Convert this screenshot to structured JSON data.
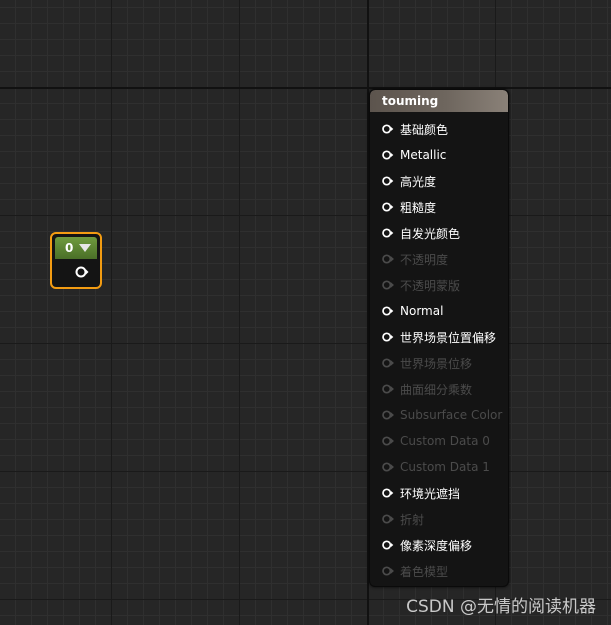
{
  "constant_node": {
    "value": "0"
  },
  "material_node": {
    "title": "touming",
    "pins": [
      {
        "label": "基础颜色",
        "enabled": true
      },
      {
        "label": "Metallic",
        "enabled": true
      },
      {
        "label": "高光度",
        "enabled": true
      },
      {
        "label": "粗糙度",
        "enabled": true
      },
      {
        "label": "自发光颜色",
        "enabled": true
      },
      {
        "label": "不透明度",
        "enabled": false
      },
      {
        "label": "不透明蒙版",
        "enabled": false
      },
      {
        "label": "Normal",
        "enabled": true
      },
      {
        "label": "世界场景位置偏移",
        "enabled": true
      },
      {
        "label": "世界场景位移",
        "enabled": false
      },
      {
        "label": "曲面细分乘数",
        "enabled": false
      },
      {
        "label": "Subsurface Color",
        "enabled": false
      },
      {
        "label": "Custom Data 0",
        "enabled": false
      },
      {
        "label": "Custom Data 1",
        "enabled": false
      },
      {
        "label": "环境光遮挡",
        "enabled": true
      },
      {
        "label": "折射",
        "enabled": false
      },
      {
        "label": "像素深度偏移",
        "enabled": true
      },
      {
        "label": "着色模型",
        "enabled": false
      }
    ]
  },
  "watermark": "CSDN @无情的阅读机器",
  "colors": {
    "canvas_background": "#262626",
    "constant_node_border": "#f39c12",
    "constant_node_header": "#5a8432",
    "material_node_header": "#6e665e",
    "pin_enabled": "#ffffff",
    "pin_disabled": "#4b4b4b"
  }
}
